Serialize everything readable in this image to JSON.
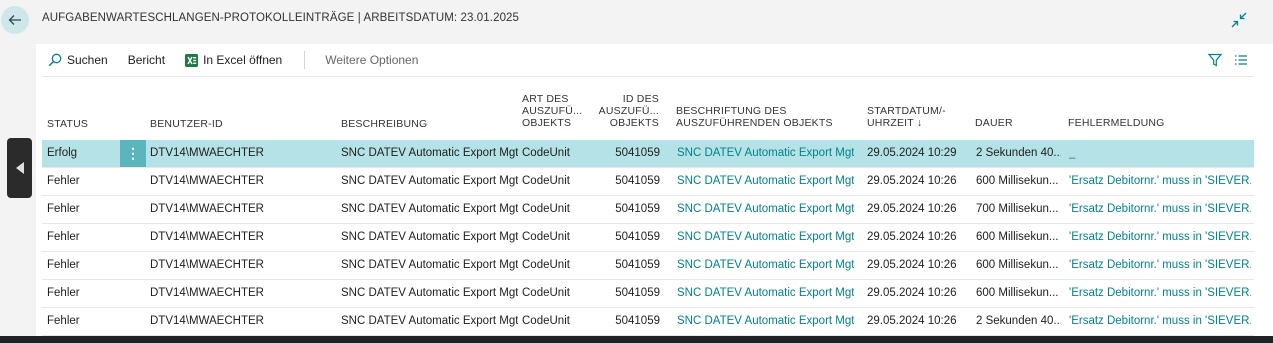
{
  "header": {
    "title": "AUFGABENWARTESCHLANGEN-PROTOKOLLEINTRÄGE | ARBEITSDATUM: 23.01.2025"
  },
  "toolbar": {
    "search_label": "Suchen",
    "report_label": "Bericht",
    "excel_label": "In Excel öffnen",
    "more_label": "Weitere Optionen"
  },
  "columns": {
    "status": "STATUS",
    "user_id": "BENUTZER-ID",
    "description": "BESCHREIBUNG",
    "object_type_1": "ART DES",
    "object_type_2": "AUSZUFÜ...",
    "object_type_3": "OBJEKTS",
    "object_id_1": "ID DES",
    "object_id_2": "AUSZUFÜ...",
    "object_id_3": "OBJEKTS",
    "caption_1": "BESCHRIFTUNG DES",
    "caption_2": "AUSZUFÜHRENDEN OBJEKTS",
    "start_1": "STARTDATUM/-",
    "start_2": "UHRZEIT ↓",
    "duration": "DAUER",
    "error": "FEHLERMELDUNG"
  },
  "rows": [
    {
      "status": "Erfolg",
      "user_id": "DTV14\\MWAECHTER",
      "description": "SNC DATEV Automatic Export Mgt",
      "object_type": "CodeUnit",
      "object_id": "5041059",
      "caption": "SNC DATEV Automatic Export Mgt",
      "start": "29.05.2024 10:29",
      "duration": "2 Sekunden 40...",
      "error": "_"
    },
    {
      "status": "Fehler",
      "user_id": "DTV14\\MWAECHTER",
      "description": "SNC DATEV Automatic Export Mgt",
      "object_type": "CodeUnit",
      "object_id": "5041059",
      "caption": "SNC DATEV Automatic Export Mgt",
      "start": "29.05.2024 10:26",
      "duration": "600 Millisekun...",
      "error": "'Ersatz Debitornr.' muss in 'SIEVER..."
    },
    {
      "status": "Fehler",
      "user_id": "DTV14\\MWAECHTER",
      "description": "SNC DATEV Automatic Export Mgt",
      "object_type": "CodeUnit",
      "object_id": "5041059",
      "caption": "SNC DATEV Automatic Export Mgt",
      "start": "29.05.2024 10:26",
      "duration": "700 Millisekun...",
      "error": "'Ersatz Debitornr.' muss in 'SIEVER..."
    },
    {
      "status": "Fehler",
      "user_id": "DTV14\\MWAECHTER",
      "description": "SNC DATEV Automatic Export Mgt",
      "object_type": "CodeUnit",
      "object_id": "5041059",
      "caption": "SNC DATEV Automatic Export Mgt",
      "start": "29.05.2024 10:26",
      "duration": "600 Millisekun...",
      "error": "'Ersatz Debitornr.' muss in 'SIEVER..."
    },
    {
      "status": "Fehler",
      "user_id": "DTV14\\MWAECHTER",
      "description": "SNC DATEV Automatic Export Mgt",
      "object_type": "CodeUnit",
      "object_id": "5041059",
      "caption": "SNC DATEV Automatic Export Mgt",
      "start": "29.05.2024 10:26",
      "duration": "600 Millisekun...",
      "error": "'Ersatz Debitornr.' muss in 'SIEVER..."
    },
    {
      "status": "Fehler",
      "user_id": "DTV14\\MWAECHTER",
      "description": "SNC DATEV Automatic Export Mgt",
      "object_type": "CodeUnit",
      "object_id": "5041059",
      "caption": "SNC DATEV Automatic Export Mgt",
      "start": "29.05.2024 10:26",
      "duration": "600 Millisekun...",
      "error": "'Ersatz Debitornr.' muss in 'SIEVER..."
    },
    {
      "status": "Fehler",
      "user_id": "DTV14\\MWAECHTER",
      "description": "SNC DATEV Automatic Export Mgt",
      "object_type": "CodeUnit",
      "object_id": "5041059",
      "caption": "SNC DATEV Automatic Export Mgt",
      "start": "29.05.2024 10:26",
      "duration": "2 Sekunden 40...",
      "error": "'Ersatz Debitornr.' muss in 'SIEVER..."
    }
  ],
  "colors": {
    "accent": "#00838a",
    "selected_row": "#b4e2e6",
    "row_menu": "#5bb5bd"
  },
  "icons": {
    "back": "back-arrow-icon",
    "collapse": "collapse-icon",
    "search": "search-icon",
    "excel": "excel-icon",
    "filter": "filter-icon",
    "list": "list-icon",
    "side": "caret-left-icon"
  }
}
